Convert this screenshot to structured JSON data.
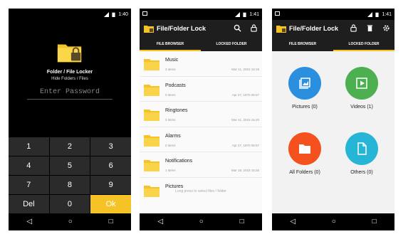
{
  "status": {
    "time": "1:40",
    "time2": "1:41",
    "time3": "1:41"
  },
  "p1": {
    "title": "Folder / File Locker",
    "subtitle": "Hide Folders / Files",
    "password_placeholder": "Enter Password",
    "keys": [
      "1",
      "2",
      "3",
      "4",
      "5",
      "6",
      "7",
      "8",
      "9",
      "Del",
      "0",
      "Ok"
    ]
  },
  "p2": {
    "app_title": "File/Folder Lock",
    "tab_browser": "FILE BROWSER",
    "tab_locked": "LOCKED FOLDER",
    "items": [
      {
        "name": "Music",
        "count": "3 items",
        "date": "Mar 11, 2015 15:19"
      },
      {
        "name": "Podcasts",
        "count": "0 items",
        "date": "Apr 27, 1970 06:57"
      },
      {
        "name": "Ringtones",
        "count": "3 items",
        "date": "Mar 11, 2015 15:20"
      },
      {
        "name": "Alarms",
        "count": "0 items",
        "date": "Apr 27, 1970 06:57"
      },
      {
        "name": "Notifications",
        "count": "1 items",
        "date": "Mar 18, 2015 16:26"
      },
      {
        "name": "Pictures",
        "count": "",
        "date": ""
      }
    ],
    "hint": "Long press to select files / folder"
  },
  "p3": {
    "app_title": "File/Folder Lock",
    "tab_browser": "FILE BROWSER",
    "tab_locked": "LOCKED FOLDER",
    "categories": [
      {
        "label": "Pictures (0)",
        "color": "#2b8fe0"
      },
      {
        "label": "Videos (1)",
        "color": "#4caf50"
      },
      {
        "label": "All Folders (0)",
        "color": "#f4511e"
      },
      {
        "label": "Others (0)",
        "color": "#26b5d6"
      }
    ]
  },
  "colors": {
    "accent": "#f6c327",
    "appbar": "#1e1e1e",
    "folder": "#f6c327"
  },
  "nav": {
    "back": "◁",
    "home": "○",
    "recent": "□"
  }
}
